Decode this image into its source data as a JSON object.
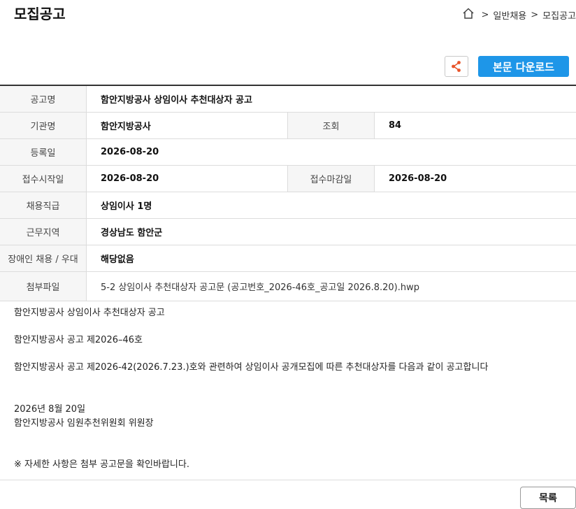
{
  "header": {
    "title": "모집공고",
    "breadcrumb": [
      "일반채용",
      "모집공고"
    ],
    "breadcrumb_sep": ">"
  },
  "actions": {
    "share_icon": "share-icon",
    "download_label": "본문 다운로드",
    "list_label": "목록"
  },
  "info": {
    "title_label": "공고명",
    "title_value": "함안지방공사 상임이사 추천대상자 공고",
    "org_label": "기관명",
    "org_value": "함안지방공사",
    "views_label": "조회",
    "views_value": "84",
    "reg_label": "등록일",
    "reg_value": "2026-08-20",
    "start_label": "접수시작일",
    "start_value": "2026-08-20",
    "end_label": "접수마감일",
    "end_value": "2026-08-20",
    "position_label": "채용직급",
    "position_value": "상임이사 1명",
    "location_label": "근무지역",
    "location_value": "경상남도 함안군",
    "disabled_label": "장애인 채용 / 우대",
    "disabled_value": "해당없음",
    "attach_label": "첨부파일",
    "attach_value": "5-2 상임이사 추천대상자 공고문 (공고번호_2026-46호_공고일 2026.8.20).hwp"
  },
  "body": {
    "line1": "함안지방공사 상임이사 추천대상자 공고",
    "line2": "함안지방공사 공고 제2026–46호",
    "line3": "함안지방공사 공고 제2026-42(2026.7.23.)호와 관련하여 상임이사 공개모집에 따른 추천대상자를 다음과 같이 공고합니다",
    "date": "2026년 8월 20일",
    "signer": "함안지방공사 임원추천위원회 위원장",
    "note": "※ 자세한 사항은 첨부 공고문을 확인바랍니다."
  }
}
